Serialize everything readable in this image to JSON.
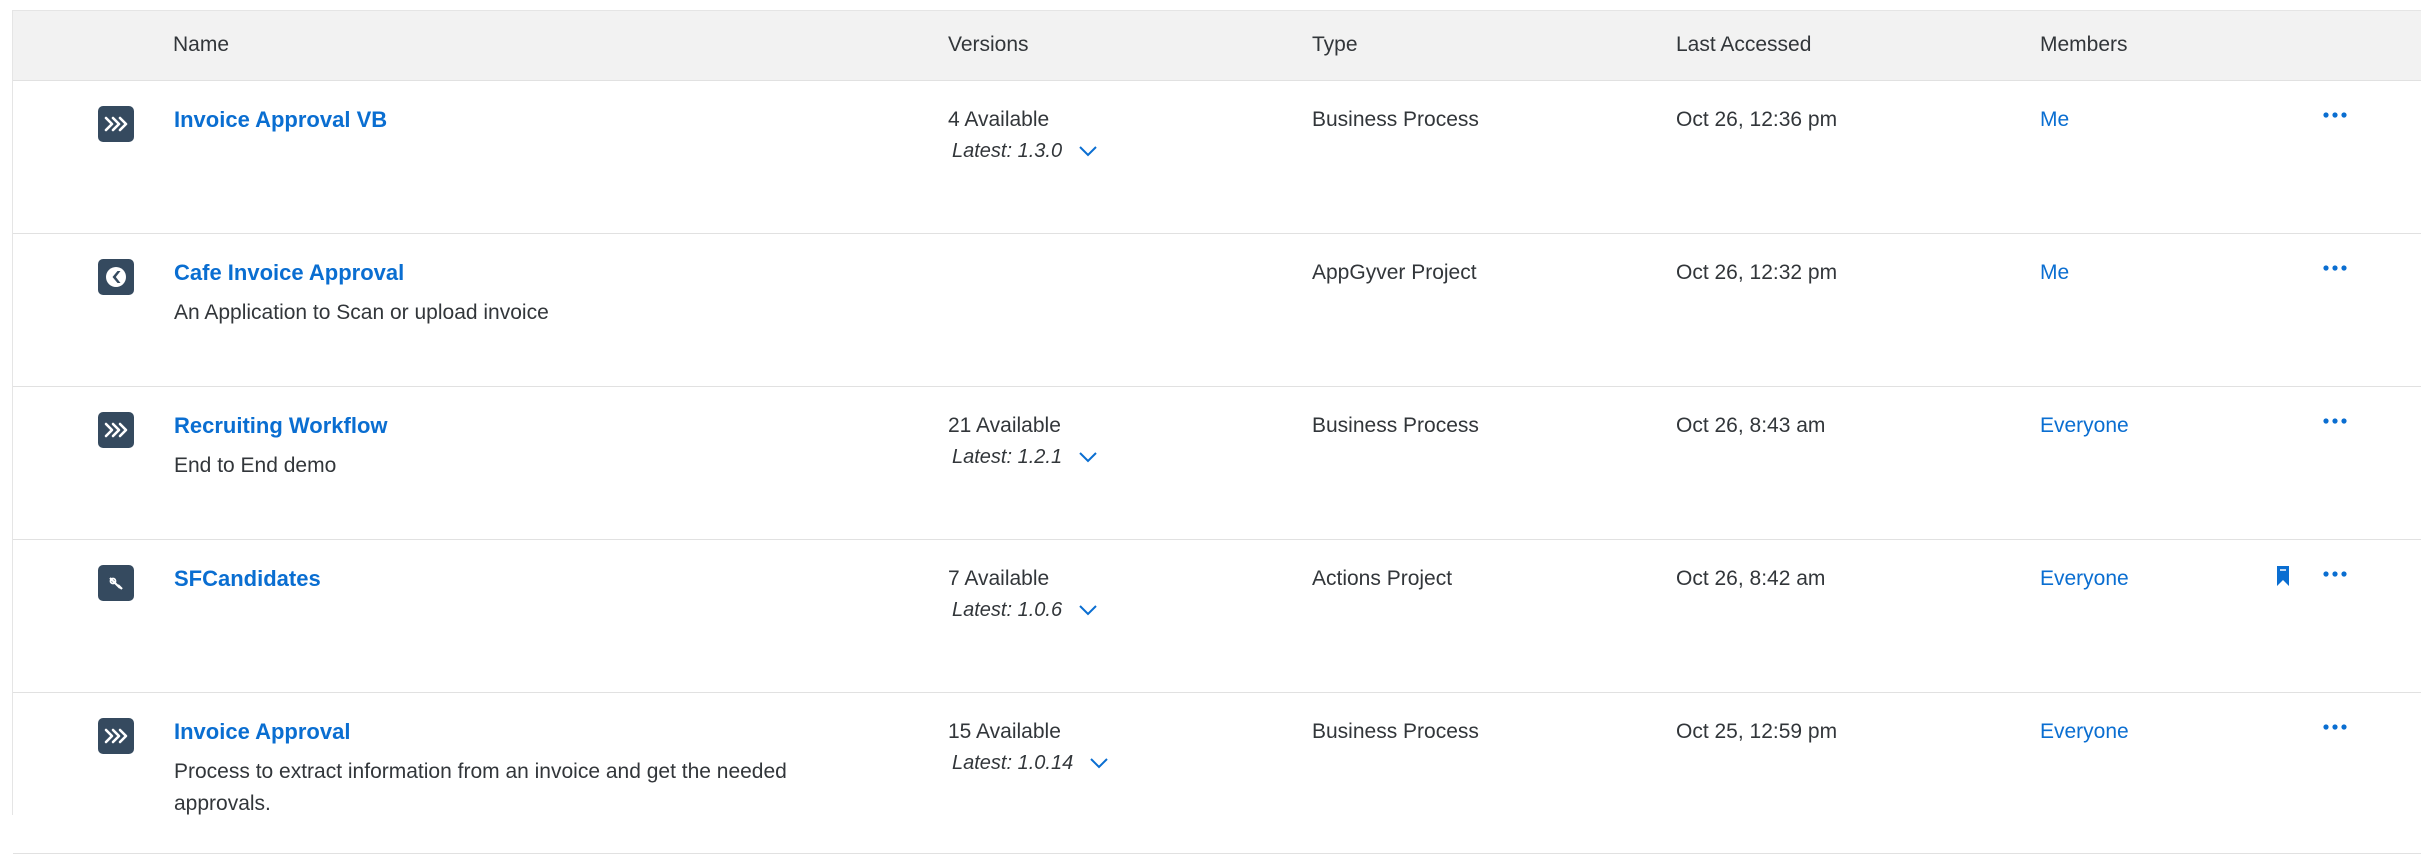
{
  "header": {
    "name": "Name",
    "versions": "Versions",
    "type": "Type",
    "last_accessed": "Last Accessed",
    "members": "Members"
  },
  "rows": [
    {
      "icon": "process-chevrons-icon",
      "name": "Invoice Approval VB",
      "description": "",
      "versions_count": "4 Available",
      "versions_latest": "Latest: 1.3.0",
      "type": "Business Process",
      "last_accessed": "Oct 26, 12:36 pm",
      "members": "Me",
      "bookmarked": false
    },
    {
      "icon": "appgyver-logo-icon",
      "name": "Cafe Invoice Approval",
      "description": "An Application to Scan or upload invoice",
      "versions_count": "",
      "versions_latest": "",
      "type": "AppGyver Project",
      "last_accessed": "Oct 26, 12:32 pm",
      "members": "Me",
      "bookmarked": false
    },
    {
      "icon": "process-chevrons-icon",
      "name": "Recruiting Workflow",
      "description": "End to End demo",
      "versions_count": "21 Available",
      "versions_latest": "Latest: 1.2.1",
      "type": "Business Process",
      "last_accessed": "Oct 26, 8:43 am",
      "members": "Everyone",
      "bookmarked": false
    },
    {
      "icon": "actions-connector-icon",
      "name": "SFCandidates",
      "description": "",
      "versions_count": "7 Available",
      "versions_latest": "Latest: 1.0.6",
      "type": "Actions Project",
      "last_accessed": "Oct 26, 8:42 am",
      "members": "Everyone",
      "bookmarked": true
    },
    {
      "icon": "process-chevrons-icon",
      "name": "Invoice Approval",
      "description": "Process to extract information from an invoice and get the needed approvals.",
      "versions_count": "15 Available",
      "versions_latest": "Latest: 1.0.14",
      "type": "Business Process",
      "last_accessed": "Oct 25, 12:59 pm",
      "members": "Everyone",
      "bookmarked": false
    }
  ],
  "colors": {
    "link": "#0a6ed1",
    "icon_bg": "#354a5f",
    "header_bg": "#f2f2f2",
    "text": "#32363a"
  }
}
